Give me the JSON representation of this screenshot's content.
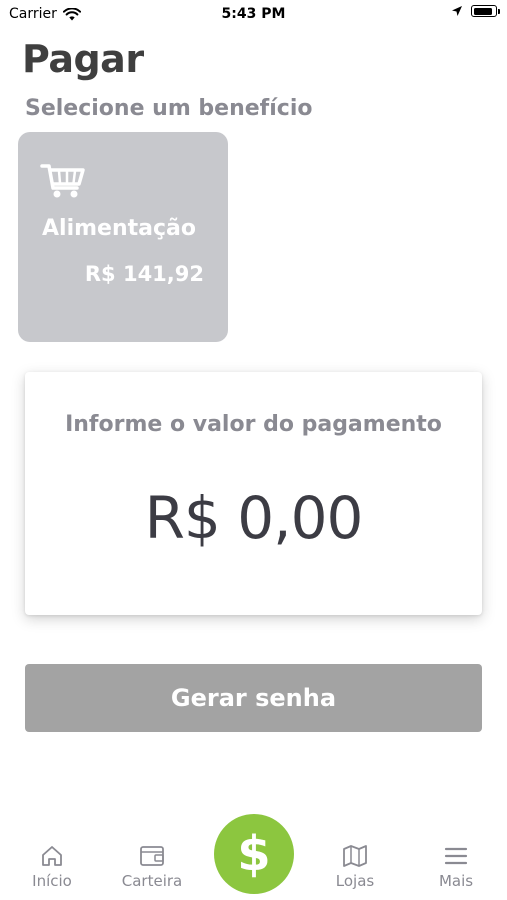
{
  "status_bar": {
    "carrier": "Carrier",
    "time": "5:43 PM",
    "battery_level": 0.9
  },
  "page": {
    "title": "Pagar",
    "section_label": "Selecione um benefício"
  },
  "benefit": {
    "name": "Alimentação",
    "balance": "R$ 141,92",
    "icon": "shopping-cart-icon"
  },
  "payment": {
    "prompt": "Informe o valor do pagamento",
    "amount": "R$ 0,00"
  },
  "actions": {
    "generate_label": "Gerar senha"
  },
  "tabs": [
    {
      "label": "Início",
      "icon": "home-icon"
    },
    {
      "label": "Carteira",
      "icon": "wallet-icon"
    },
    {
      "label": "$",
      "icon": "dollar-icon"
    },
    {
      "label": "Lojas",
      "icon": "map-icon"
    },
    {
      "label": "Mais",
      "icon": "menu-icon"
    }
  ],
  "colors": {
    "accent_green": "#8cc63f",
    "card_gray": "#c7c8cc",
    "button_gray": "#a3a3a3",
    "title_text": "#3f3f3f",
    "muted_text": "#8a8a92"
  }
}
